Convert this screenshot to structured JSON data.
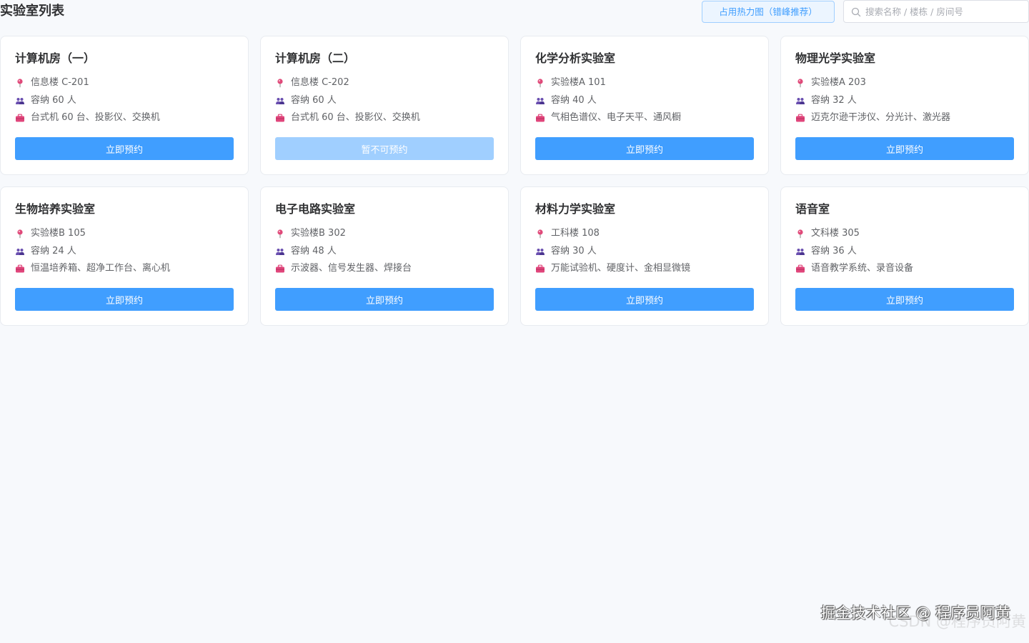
{
  "header": {
    "title": "实验室列表",
    "heatmap_button_label": "占用热力图（错峰推荐）",
    "search_placeholder": "搜索名称 / 楼栋 / 房间号"
  },
  "icons": {
    "location": "location-pin-icon",
    "capacity": "people-icon",
    "equipment": "toolbox-icon",
    "search": "search-icon"
  },
  "colors": {
    "primary": "#409eff",
    "primary_disabled": "#a0cfff",
    "pin": "#e04a7a",
    "people": "#6a4fb0",
    "toolbox": "#e0457b"
  },
  "labs": [
    {
      "name": "计算机房（一）",
      "location": "信息楼 C-201",
      "capacity": "容纳 60 人",
      "equipment": "台式机 60 台、投影仪、交换机",
      "button": "立即预约",
      "available": true
    },
    {
      "name": "计算机房（二）",
      "location": "信息楼 C-202",
      "capacity": "容纳 60 人",
      "equipment": "台式机 60 台、投影仪、交换机",
      "button": "暂不可预约",
      "available": false
    },
    {
      "name": "化学分析实验室",
      "location": "实验楼A 101",
      "capacity": "容纳 40 人",
      "equipment": "气相色谱仪、电子天平、通风橱",
      "button": "立即预约",
      "available": true
    },
    {
      "name": "物理光学实验室",
      "location": "实验楼A 203",
      "capacity": "容纳 32 人",
      "equipment": "迈克尔逊干涉仪、分光计、激光器",
      "button": "立即预约",
      "available": true
    },
    {
      "name": "生物培养实验室",
      "location": "实验楼B 105",
      "capacity": "容纳 24 人",
      "equipment": "恒温培养箱、超净工作台、离心机",
      "button": "立即预约",
      "available": true
    },
    {
      "name": "电子电路实验室",
      "location": "实验楼B 302",
      "capacity": "容纳 48 人",
      "equipment": "示波器、信号发生器、焊接台",
      "button": "立即预约",
      "available": true
    },
    {
      "name": "材料力学实验室",
      "location": "工科楼 108",
      "capacity": "容纳 30 人",
      "equipment": "万能试验机、硬度计、金相显微镜",
      "button": "立即预约",
      "available": true
    },
    {
      "name": "语音室",
      "location": "文科楼 305",
      "capacity": "容纳 36 人",
      "equipment": "语音教学系统、录音设备",
      "button": "立即预约",
      "available": true
    }
  ],
  "watermark": {
    "main": "掘金技术社区 @ 程序员阿黄",
    "sub": "CSDN @程序员阿黄"
  }
}
